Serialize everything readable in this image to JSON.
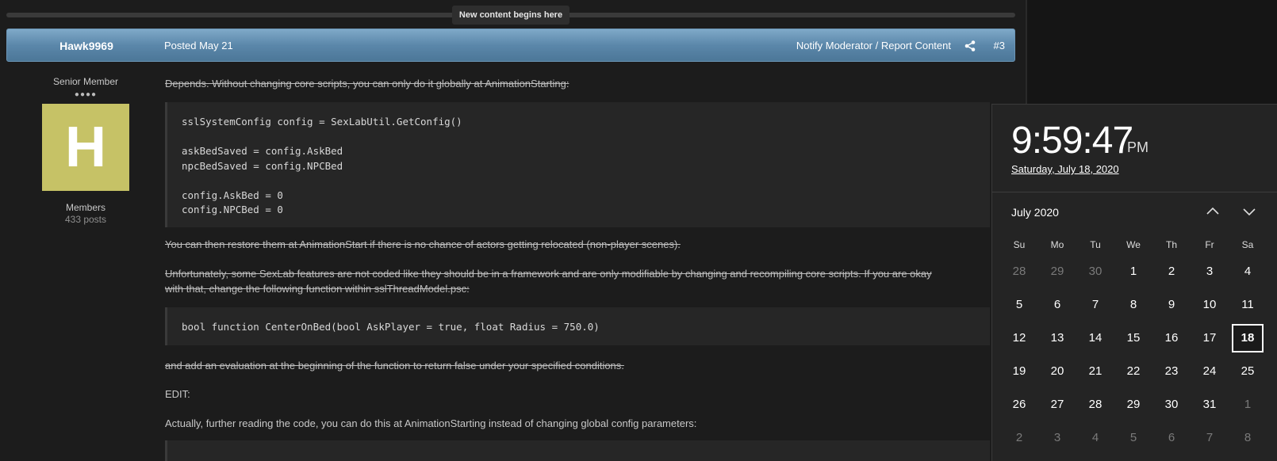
{
  "banner": {
    "new_content": "New content begins here"
  },
  "post": {
    "author": "Hawk9969",
    "posted": "Posted May 21",
    "report": "Notify Moderator / Report Content",
    "number": "#3",
    "rank": "Senior Member",
    "pips": "●●●●",
    "avatar_letter": "H",
    "avatar_color": "#c6c266",
    "group": "Members",
    "post_count": "433 posts"
  },
  "content": {
    "p1": "Depends. Without changing core scripts, you can only do it globally at AnimationStarting:",
    "code1": "sslSystemConfig config = SexLabUtil.GetConfig()\n\naskBedSaved = config.AskBed\nnpcBedSaved = config.NPCBed\n\nconfig.AskBed = 0\nconfig.NPCBed = 0",
    "p2": "You can then restore them at AnimationStart if there is no chance of actors getting relocated (non-player scenes).",
    "p3a": "Unfortunately, some SexLab features are not coded like they should be in a framework and are only modifiable by changing and recompiling core scripts. If you are okay",
    "p3b": "with that, change the following function within sslThreadModel.psc:",
    "code2": "bool function CenterOnBed(bool AskPlayer = true, float Radius = 750.0)",
    "p4": "and add an evaluation at the beginning of the function to return false under your specified conditions.",
    "p5": "EDIT:",
    "p6": "Actually, further reading the code, you can do this at AnimationStarting instead of changing global config parameters:"
  },
  "flyout": {
    "time": "9:59:47",
    "ampm": "PM",
    "full_date": "Saturday, July 18, 2020",
    "month": "July 2020",
    "weekdays": [
      "Su",
      "Mo",
      "Tu",
      "We",
      "Th",
      "Fr",
      "Sa"
    ],
    "weeks": [
      [
        "28",
        "29",
        "30",
        "1",
        "2",
        "3",
        "4"
      ],
      [
        "5",
        "6",
        "7",
        "8",
        "9",
        "10",
        "11"
      ],
      [
        "12",
        "13",
        "14",
        "15",
        "16",
        "17",
        "18"
      ],
      [
        "19",
        "20",
        "21",
        "22",
        "23",
        "24",
        "25"
      ],
      [
        "26",
        "27",
        "28",
        "29",
        "30",
        "31",
        "1"
      ],
      [
        "2",
        "3",
        "4",
        "5",
        "6",
        "7",
        "8"
      ]
    ],
    "today": "18"
  }
}
